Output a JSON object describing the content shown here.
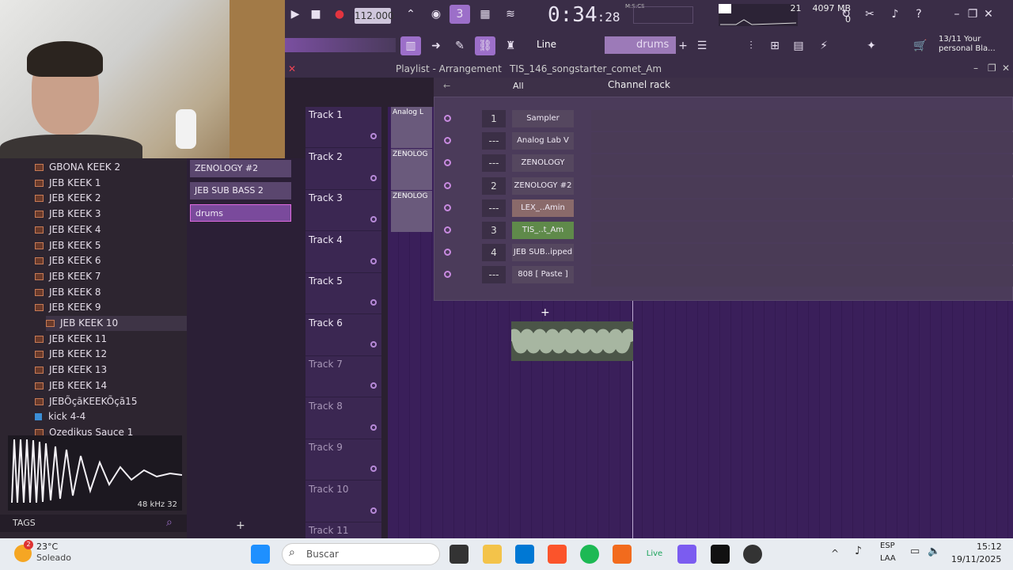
{
  "transport": {
    "tempo": "112.000",
    "time": "0:34",
    "time_small": ":28",
    "mscs": "M:S:CS",
    "cpu_value": "21",
    "memory": "4097 MB",
    "memory_sub": "0",
    "snap_mode": "Line",
    "pattern_name": "drums",
    "hint_line1": "13/11 Your",
    "hint_line2": "personal Bla..."
  },
  "playlist": {
    "title": "Playlist - Arrangement",
    "project": "TIS_146_songstarter_comet_Am",
    "tracks": [
      "Track 1",
      "Track 2",
      "Track 3",
      "Track 4",
      "Track 5",
      "Track 6",
      "Track 7",
      "Track 8",
      "Track 9",
      "Track 10",
      "Track 11"
    ],
    "clip_a": "Analog L",
    "clip_b": "ZENOLOG",
    "clip_c": "ZENOLOG"
  },
  "channel_rack": {
    "title": "Channel rack",
    "filter": "All",
    "channels": [
      {
        "num": "1",
        "name": "Sampler"
      },
      {
        "num": "---",
        "name": "Analog Lab V"
      },
      {
        "num": "---",
        "name": "ZENOLOGY"
      },
      {
        "num": "2",
        "name": "ZENOLOGY #2"
      },
      {
        "num": "---",
        "name": "LEX_..Amin"
      },
      {
        "num": "3",
        "name": "TIS_..t_Am"
      },
      {
        "num": "4",
        "name": "JEB SUB..ipped"
      },
      {
        "num": "---",
        "name": "808 [ Paste ]"
      }
    ]
  },
  "picker": {
    "items": [
      "ZENOLOGY #2",
      "JEB SUB BASS 2 [clipped]",
      "drums"
    ]
  },
  "browser": {
    "items": [
      "GBONA KEEK 2",
      "JEB KEEK 1",
      "JEB KEEK 2",
      "JEB KEEK 3",
      "JEB KEEK 4",
      "JEB KEEK 5",
      "JEB KEEK 6",
      "JEB KEEK 7",
      "JEB KEEK 8",
      "JEB KEEK 9",
      "JEB KEEK 10",
      "JEB KEEK 11",
      "JEB KEEK 12",
      "JEB KEEK 13",
      "JEB KEEK 14",
      "JEBÕçãKEEKÕçã15",
      "kick 4-4",
      "Ozedikus Sauce 1"
    ],
    "sample_info": "48 kHz 32",
    "tags_label": "TAGS"
  },
  "taskbar": {
    "weather_temp": "23°C",
    "weather_desc": "Soleado",
    "weather_badge": "2",
    "search_placeholder": "Buscar",
    "lang1": "ESP",
    "lang2": "LAA",
    "clock_time": "15:12",
    "clock_date": "19/11/2025"
  }
}
